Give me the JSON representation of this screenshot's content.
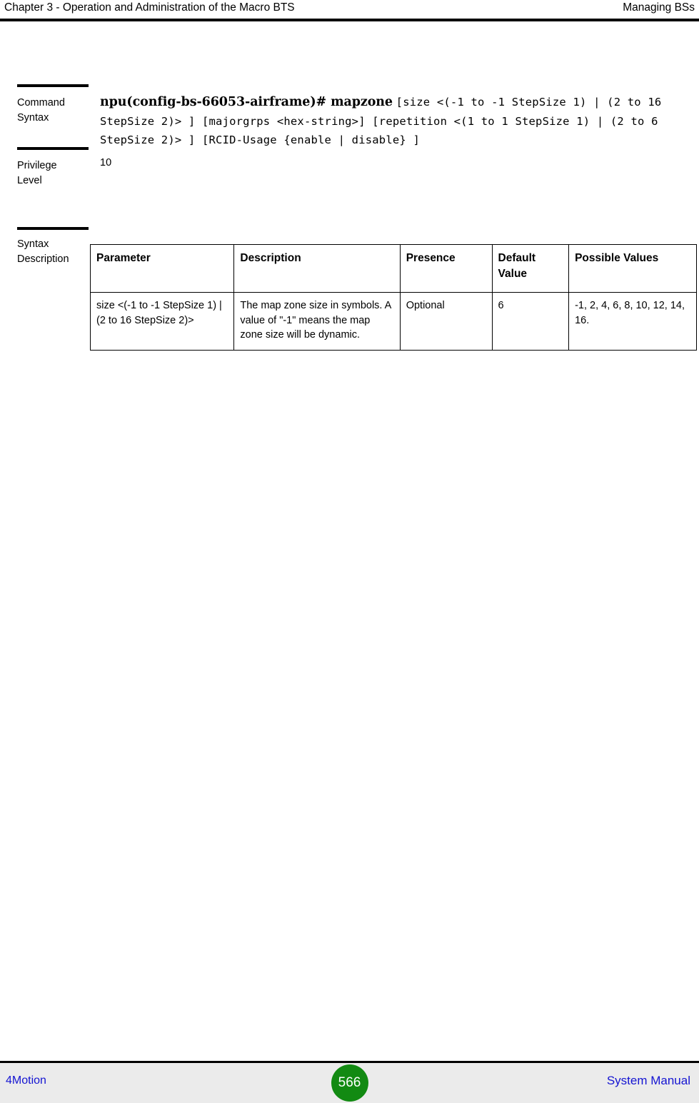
{
  "header": {
    "left": "Chapter 3 - Operation and Administration of the Macro BTS",
    "right": "Managing BSs"
  },
  "sections": {
    "command": {
      "label_line1": "Command",
      "label_line2": "Syntax",
      "command_bold": "npu(config-bs-66053-airframe)# mapzone",
      "command_args": "[size <(-1 to -1 StepSize 1) | (2 to 16 StepSize 2)> ] [majorgrps <hex-string>] [repetition <(1 to 1 StepSize 1) | (2 to 6 StepSize 2)> ] [RCID-Usage {enable | disable} ]"
    },
    "privilege": {
      "label_line1": "Privilege",
      "label_line2": "Level",
      "value": "10"
    },
    "syntax_description": {
      "label_line1": "Syntax",
      "label_line2": "Description",
      "table": {
        "headers": [
          "Parameter",
          "Description",
          "Presence",
          "Default Value",
          "Possible Values"
        ],
        "rows": [
          {
            "parameter": "size <(-1 to -1 StepSize 1) | (2 to 16 StepSize 2)>",
            "description": "The map zone size in symbols. A value of \"-1\" means the map zone size will be dynamic.",
            "presence": "Optional",
            "default_value": "6",
            "possible_values": "-1, 2, 4, 6, 8, 10, 12, 14, 16."
          }
        ]
      }
    }
  },
  "footer": {
    "left": "4Motion",
    "page_number": "566",
    "right": "System Manual"
  }
}
